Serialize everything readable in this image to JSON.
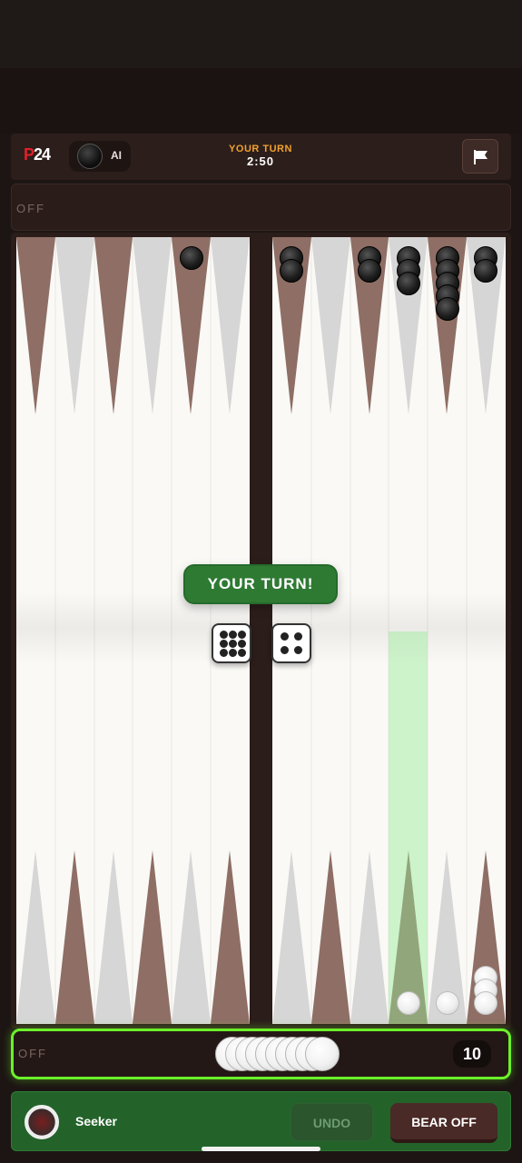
{
  "header": {
    "logo_prefix": "P",
    "logo_suffix": "24",
    "opponent_label": "AI",
    "turn_label": "YOUR TURN",
    "timer": "2:50"
  },
  "off_tray_top": {
    "label": "OFF"
  },
  "off_tray_bottom": {
    "label": "OFF",
    "borne_off_count": "10"
  },
  "board": {
    "colors": {
      "point_dark": "#8e6e65",
      "point_light": "#d6d6d6",
      "board_bg": "#faf9f6",
      "frame": "#2b1d1a",
      "highlight": "#9be89b"
    },
    "top_points_left_half": [
      0,
      0,
      0,
      0,
      1,
      0
    ],
    "top_points_right_half": [
      2,
      0,
      2,
      3,
      5,
      2
    ],
    "bottom_points_right_half": [
      0,
      0,
      0,
      1,
      1,
      3
    ],
    "top_checker_color": "black",
    "bottom_checker_color": "white",
    "highlighted_point": "bottom-right-4"
  },
  "overlay": {
    "banner": "YOUR TURN!",
    "dice": [
      6,
      4
    ]
  },
  "footer": {
    "player_name": "Seeker",
    "undo_label": "UNDO",
    "bear_off_label": "BEAR OFF"
  }
}
